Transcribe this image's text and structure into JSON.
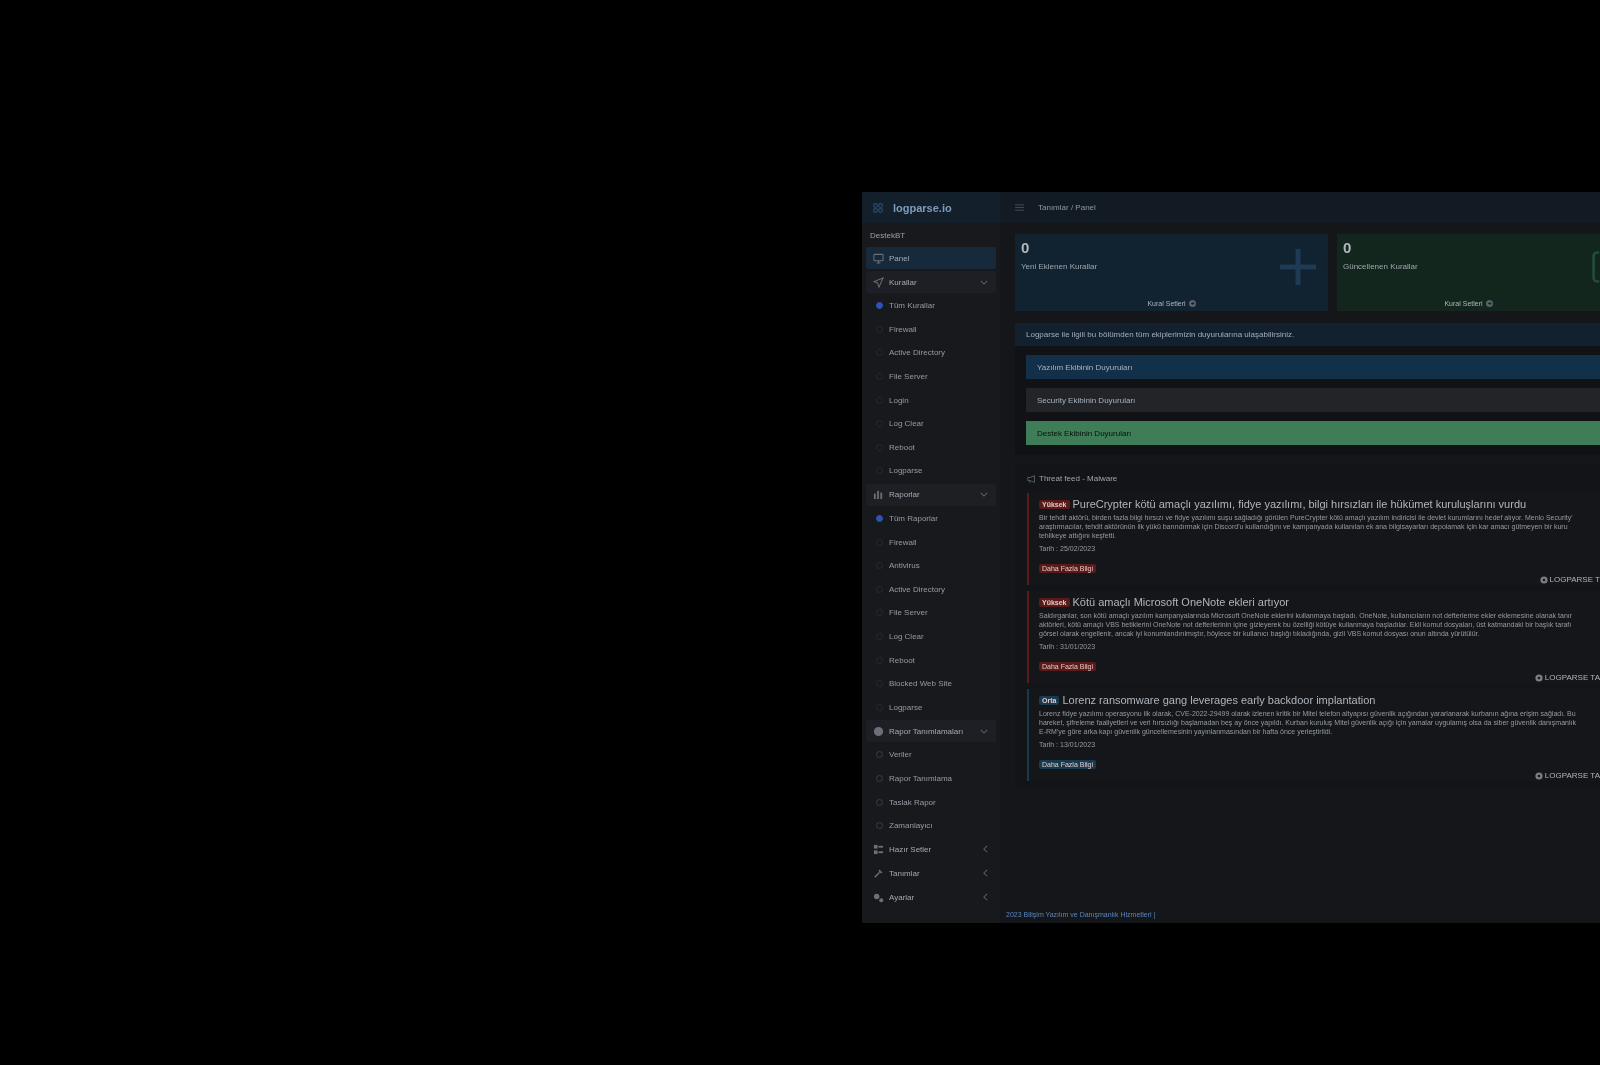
{
  "sidebar": {
    "brand": "logparse.io",
    "section": "DestekBT",
    "items": [
      {
        "label": "Panel",
        "selected": true
      },
      {
        "label": "Kurallar",
        "selected": false,
        "expanded": true,
        "children": [
          {
            "label": "Tüm Kurallar",
            "selected": true
          },
          {
            "label": "Firewall",
            "selected": false
          },
          {
            "label": "Active Directory",
            "selected": false
          },
          {
            "label": "File Server",
            "selected": false
          },
          {
            "label": "Login",
            "selected": false
          },
          {
            "label": "Log Clear",
            "selected": false
          },
          {
            "label": "Reboot",
            "selected": false
          },
          {
            "label": "Logparse",
            "selected": false
          }
        ]
      },
      {
        "label": "Raporlar",
        "selected": false,
        "expanded": true,
        "children": [
          {
            "label": "Tüm Raporlar",
            "selected": true
          },
          {
            "label": "Firewall",
            "selected": false
          },
          {
            "label": "Antivirus",
            "selected": false
          },
          {
            "label": "Active Directory",
            "selected": false
          },
          {
            "label": "File Server",
            "selected": false
          },
          {
            "label": "Log Clear",
            "selected": false
          },
          {
            "label": "Reboot",
            "selected": false
          },
          {
            "label": "Blocked Web Site",
            "selected": false
          },
          {
            "label": "Logparse",
            "selected": false
          }
        ]
      },
      {
        "label": "Rapor Tanımlamaları",
        "selected": false,
        "expanded": true,
        "children": [
          {
            "label": "Veriler",
            "selected": false
          },
          {
            "label": "Rapor Tanımlama",
            "selected": false
          },
          {
            "label": "Taslak Rapor",
            "selected": false
          },
          {
            "label": "Zamanlayıcı",
            "selected": false
          }
        ]
      },
      {
        "label": "Hazır Setler",
        "selected": false,
        "expanded": false
      },
      {
        "label": "Tanımlar",
        "selected": false,
        "expanded": false
      },
      {
        "label": "Ayarlar",
        "selected": false,
        "expanded": false
      }
    ]
  },
  "header": {
    "breadcrumb": "Tanımlar / Panel"
  },
  "stats": [
    {
      "value": "0",
      "label": "Yeni Eklenen Kurallar",
      "link": "Kural Setleri",
      "color": "#112231"
    },
    {
      "value": "0",
      "label": "Güncellenen Kurallar",
      "link": "Kural Setleri",
      "color": "#13261d"
    }
  ],
  "announcements": {
    "intro": "Logparse ile ilgili bu bölümden tüm ekiplerimizin duyurularına ulaşabilirsiniz.",
    "teams": [
      {
        "label": "Yazılım Ekibinin Duyuruları",
        "color": "#13304a"
      },
      {
        "label": "Security Ekibinin Duyuruları",
        "color": "#222427"
      },
      {
        "label": "Destek Ekibinin Duyuruları",
        "color": "#3f7d58"
      }
    ]
  },
  "threat_feed": {
    "title": "Threat feed - Malware",
    "items": [
      {
        "severity": "Yüksek",
        "color": "#5a1a1a",
        "title": "PureCrypter kötü amaçlı yazılımı, fidye yazılımı, bilgi hırsızları ile hükümet kuruluşlarını vurdu",
        "description_lines": [
          "Bir tehdit aktörü, birden fazla bilgi hırsızı ve fidye yazılımı suşu sağladığı görülen PureCrypter kötü amaçlı yazılım indiricisi ile devlet kurumlarını hedef alıyor. Menlo Security'",
          "araştırmacılar, tehdit aktörünün ilk yükü barındırmak için Discord'u kullandığını ve kampanyada kullanılan ek ana bilgisayarları depolamak için kar amacı gütmeyen bir kuru",
          "tehlikeye attığını keşfetti."
        ],
        "date": "Tarih : 25/02/2023",
        "more": "Daha Fazla Bilgi",
        "source": "LOGPARSE T"
      },
      {
        "severity": "Yüksek",
        "color": "#5a1a1a",
        "title": "Kötü amaçlı Microsoft OneNote ekleri artıyor",
        "description_lines": [
          "Saldırganlar, son kötü amaçlı yazılım kampanyalarında Microsoft OneNote eklerini kullanmaya başladı. OneNote, kullanıcıların not defterlerine ekler eklemesine olanak tanır",
          "aktörleri, kötü amaçlı VBS betiklerini OneNote not defterlerinin içine gizleyerek bu özelliği kötüye kullanmaya başladılar. Ekli komut dosyaları, üst katmandaki bir başlık tarafı",
          "görsel olarak engellenir, ancak iyi konumlandırılmıştır, böylece bir kullanıcı başlığı tıkladığında, gizli VBS komut dosyası onun altında yürütülür."
        ],
        "date": "Tarih : 31/01/2023",
        "more": "Daha Fazla Bilgi",
        "source": "LOGPARSE TA"
      },
      {
        "severity": "Orta",
        "color": "#173a4f",
        "title": "Lorenz ransomware gang leverages early backdoor implantation",
        "description_lines": [
          "Lorenz fidye yazılımı operasyonu ilk olarak, CVE-2022-29499 olarak izlenen kritik bir Mitel telefon altyapısı güvenlik açığından yararlanarak kurbanın ağına erişim sağladı. Bu",
          "hareket, şifreleme faaliyetleri ve veri hırsızlığı başlamadan beş ay önce yapıldı. Kurban kuruluş Mitel güvenlik açığı için yamalar uygulamış olsa da siber güvenlik danışmanlık",
          "E-RM'ye göre arka kapı güvenlik güncellemesinin yayınlanmasından bir hafta önce yerleştirildi."
        ],
        "date": "Tarih : 13/01/2023",
        "more": "Daha Fazla Bilgi",
        "source": "LOGPARSE TA"
      }
    ]
  },
  "footer": "2023 Bilişim Yazılım ve Danışmanlık Hizmetleri |"
}
